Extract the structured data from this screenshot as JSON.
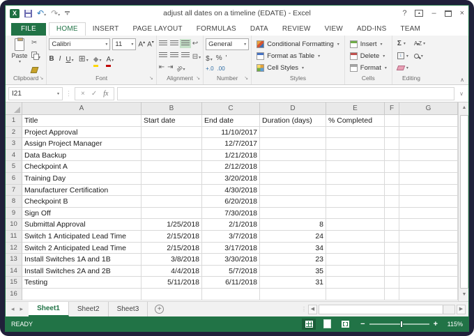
{
  "colors": {
    "accent": "#217346",
    "status_bg": "#217346",
    "selected_align_bg": "#c5e0c8"
  },
  "window": {
    "title": "adjust all dates on a timeline (EDATE) - Excel",
    "controls": {
      "help": "?",
      "minimize": "–",
      "close": "×"
    }
  },
  "ribbon": {
    "tabs": [
      {
        "label": "FILE",
        "file": true,
        "active": false
      },
      {
        "label": "HOME",
        "file": false,
        "active": true
      },
      {
        "label": "INSERT",
        "file": false,
        "active": false
      },
      {
        "label": "PAGE LAYOUT",
        "file": false,
        "active": false
      },
      {
        "label": "FORMULAS",
        "file": false,
        "active": false
      },
      {
        "label": "DATA",
        "file": false,
        "active": false
      },
      {
        "label": "REVIEW",
        "file": false,
        "active": false
      },
      {
        "label": "VIEW",
        "file": false,
        "active": false
      },
      {
        "label": "ADD-INS",
        "file": false,
        "active": false
      },
      {
        "label": "TEAM",
        "file": false,
        "active": false
      }
    ],
    "clipboard": {
      "label": "Clipboard",
      "paste": "Paste"
    },
    "font": {
      "label": "Font",
      "name": "Calibri",
      "size": "11",
      "bold": "B",
      "italic": "I",
      "underline": "U"
    },
    "alignment": {
      "label": "Alignment"
    },
    "number": {
      "label": "Number",
      "format": "General",
      "currency": "$",
      "percent": "%",
      "comma": "'",
      "inc_dec": "+.0",
      "dec_dec": ".00"
    },
    "styles": {
      "label": "Styles",
      "cf": "Conditional Formatting",
      "fat": "Format as Table",
      "cs": "Cell Styles"
    },
    "cells": {
      "label": "Cells",
      "insert": "Insert",
      "delete": "Delete",
      "format": "Format"
    },
    "editing": {
      "label": "Editing",
      "autosum": "Σ"
    }
  },
  "formula_bar": {
    "name_box": "I21",
    "fx": "fx",
    "cancel": "×",
    "enter": "✓",
    "value": ""
  },
  "grid": {
    "columns": [
      "A",
      "B",
      "C",
      "D",
      "E",
      "F",
      "G"
    ]
  },
  "sheet": {
    "headers": [
      "Title",
      "Start date",
      "End date",
      "Duration (days)",
      "% Completed"
    ],
    "rows": [
      {
        "n": 1,
        "cells": [
          "Title",
          "Start date",
          "End date",
          "Duration (days)",
          "% Completed"
        ]
      },
      {
        "n": 2,
        "cells": [
          "Project Approval",
          "",
          "11/10/2017",
          "",
          ""
        ]
      },
      {
        "n": 3,
        "cells": [
          "Assign Project Manager",
          "",
          "12/7/2017",
          "",
          ""
        ]
      },
      {
        "n": 4,
        "cells": [
          "Data Backup",
          "",
          "1/21/2018",
          "",
          ""
        ]
      },
      {
        "n": 5,
        "cells": [
          "Checkpoint A",
          "",
          "2/12/2018",
          "",
          ""
        ]
      },
      {
        "n": 6,
        "cells": [
          "Training Day",
          "",
          "3/20/2018",
          "",
          ""
        ]
      },
      {
        "n": 7,
        "cells": [
          "Manufacturer Certification",
          "",
          "4/30/2018",
          "",
          ""
        ]
      },
      {
        "n": 8,
        "cells": [
          "Checkpoint B",
          "",
          "6/20/2018",
          "",
          ""
        ]
      },
      {
        "n": 9,
        "cells": [
          "Sign Off",
          "",
          "7/30/2018",
          "",
          ""
        ]
      },
      {
        "n": 10,
        "cells": [
          "Submittal Approval",
          "1/25/2018",
          "2/1/2018",
          "8",
          ""
        ]
      },
      {
        "n": 11,
        "cells": [
          "Switch 1 Anticipated Lead Time",
          "2/15/2018",
          "3/7/2018",
          "24",
          ""
        ]
      },
      {
        "n": 12,
        "cells": [
          "Switch 2 Anticipated Lead Time",
          "2/15/2018",
          "3/17/2018",
          "34",
          ""
        ]
      },
      {
        "n": 13,
        "cells": [
          "Install Switches 1A and 1B",
          "3/8/2018",
          "3/30/2018",
          "23",
          ""
        ]
      },
      {
        "n": 14,
        "cells": [
          "Install Switches 2A and 2B",
          "4/4/2018",
          "5/7/2018",
          "35",
          ""
        ]
      },
      {
        "n": 15,
        "cells": [
          "Testing",
          "5/11/2018",
          "6/11/2018",
          "31",
          ""
        ]
      },
      {
        "n": 16,
        "cells": [
          "",
          "",
          "",
          "",
          ""
        ]
      }
    ]
  },
  "sheet_tabs": {
    "tabs": [
      "Sheet1",
      "Sheet2",
      "Sheet3"
    ],
    "active": "Sheet1"
  },
  "status": {
    "mode": "READY",
    "zoom": "115%",
    "zoom_minus": "−",
    "zoom_plus": "+"
  }
}
